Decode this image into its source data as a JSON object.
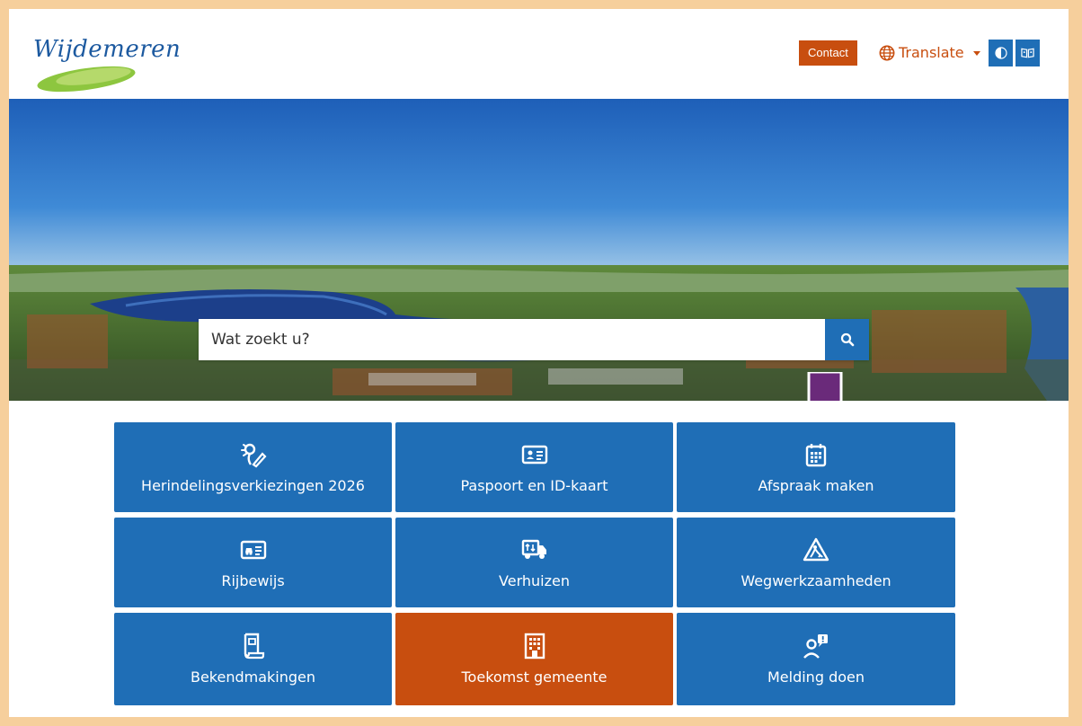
{
  "header": {
    "logo_text": "Wijdemeren",
    "contact_label": "Contact",
    "translate_label": "Translate",
    "contrast_icon": "contrast-icon",
    "reader_icon": "reader-icon"
  },
  "search": {
    "placeholder": "Wat zoekt u?",
    "button_icon": "search-icon"
  },
  "tiles": [
    {
      "label": "Herindelingsverkiezingen 2026",
      "icon": "voting-icon",
      "color": "#1f6eb6"
    },
    {
      "label": "Paspoort en ID-kaart",
      "icon": "id-card-icon",
      "color": "#1f6eb6"
    },
    {
      "label": "Afspraak maken",
      "icon": "calendar-icon",
      "color": "#1f6eb6"
    },
    {
      "label": "Rijbewijs",
      "icon": "drivers-license-icon",
      "color": "#1f6eb6"
    },
    {
      "label": "Verhuizen",
      "icon": "moving-truck-icon",
      "color": "#1f6eb6"
    },
    {
      "label": "Wegwerkzaamheden",
      "icon": "roadwork-icon",
      "color": "#1f6eb6"
    },
    {
      "label": "Bekendmakingen",
      "icon": "announcement-icon",
      "color": "#1f6eb6"
    },
    {
      "label": "Toekomst gemeente",
      "icon": "building-icon",
      "color": "#c84e0f"
    },
    {
      "label": "Melding doen",
      "icon": "report-person-icon",
      "color": "#1f6eb6"
    }
  ],
  "colors": {
    "primary": "#1f6eb6",
    "accent": "#c84e0f",
    "arrow": "#6a2a7a",
    "frame": "#f6cf9c"
  }
}
